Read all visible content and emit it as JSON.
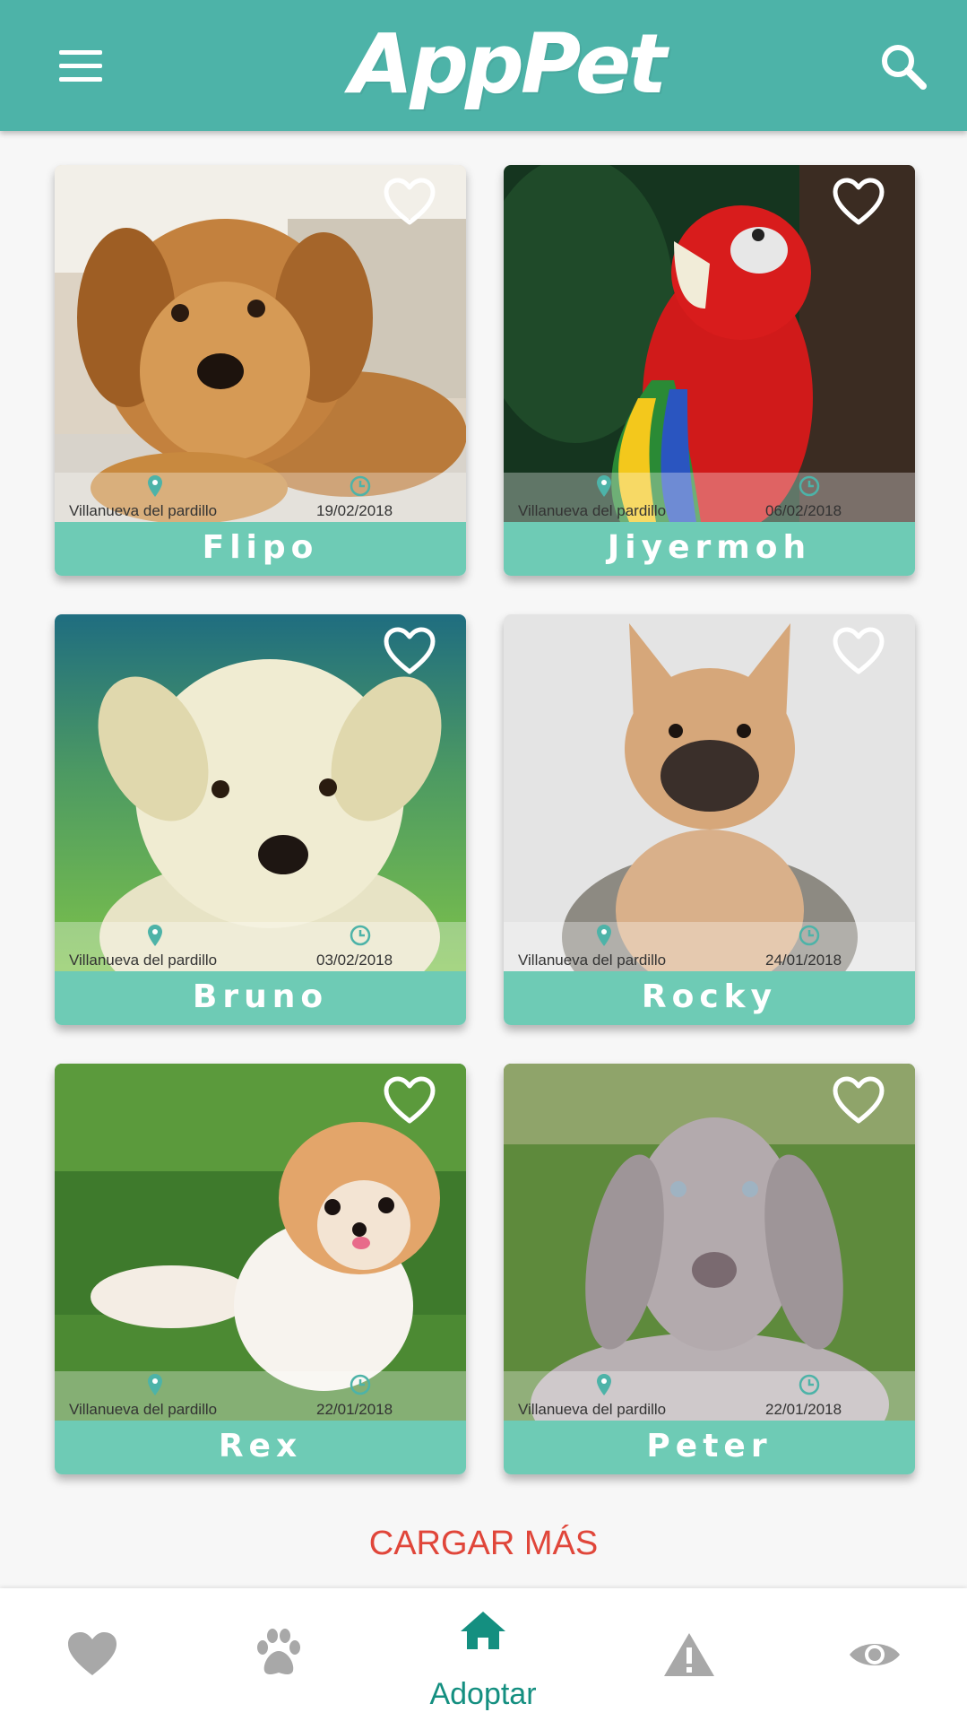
{
  "app": {
    "title": "AppPet"
  },
  "colors": {
    "primary": "#4db3a8",
    "name_bar": "#6ecbb5",
    "load_more": "#e0463a",
    "nav_active": "#148f80",
    "nav_inactive": "#a8a8a8"
  },
  "header": {
    "menu_icon": "menu-icon",
    "search_icon": "search-icon"
  },
  "pets": [
    {
      "name": "Flipo",
      "location": "Villanueva del pardillo",
      "date": "19/02/2018"
    },
    {
      "name": "Jiyermoh",
      "location": "Villanueva del pardillo",
      "date": "06/02/2018"
    },
    {
      "name": "Bruno",
      "location": "Villanueva del pardillo",
      "date": "03/02/2018"
    },
    {
      "name": "Rocky",
      "location": "Villanueva del pardillo",
      "date": "24/01/2018"
    },
    {
      "name": "Rex",
      "location": "Villanueva del pardillo",
      "date": "22/01/2018"
    },
    {
      "name": "Peter",
      "location": "Villanueva del pardillo",
      "date": "22/01/2018"
    }
  ],
  "load_more": "CARGAR MÁS",
  "bottom_nav": {
    "items": [
      {
        "icon": "heart-icon"
      },
      {
        "icon": "paw-icon"
      },
      {
        "icon": "home-icon",
        "label": "Adoptar",
        "active": true
      },
      {
        "icon": "warning-icon"
      },
      {
        "icon": "eye-icon"
      }
    ]
  }
}
